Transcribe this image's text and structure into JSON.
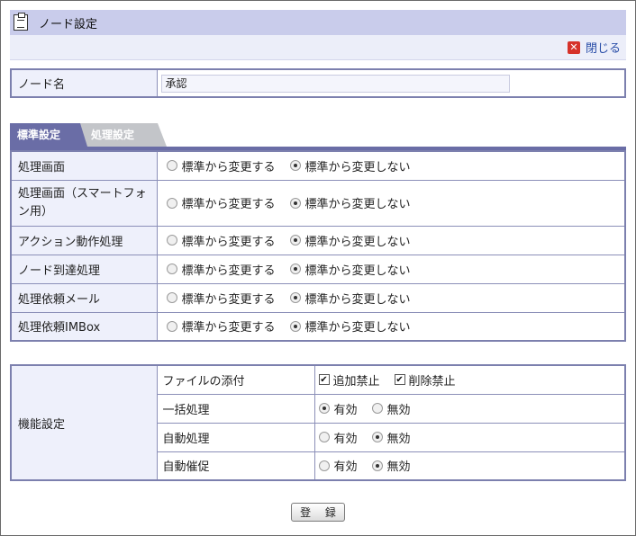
{
  "header": {
    "title": "ノード設定",
    "close_label": "閉じる"
  },
  "node_name": {
    "label": "ノード名",
    "value": "承認"
  },
  "tabs": [
    {
      "label": "標準設定",
      "active": true
    },
    {
      "label": "処理設定",
      "active": false
    }
  ],
  "radio_options": {
    "change": "標準から変更する",
    "no_change": "標準から変更しない"
  },
  "standard_settings": [
    {
      "label": "処理画面",
      "selected": "no_change"
    },
    {
      "label": "処理画面（スマートフォン用）",
      "selected": "no_change"
    },
    {
      "label": "アクション動作処理",
      "selected": "no_change"
    },
    {
      "label": "ノード到達処理",
      "selected": "no_change"
    },
    {
      "label": "処理依頼メール",
      "selected": "no_change"
    },
    {
      "label": "処理依頼IMBox",
      "selected": "no_change"
    }
  ],
  "function_settings": {
    "label": "機能設定",
    "attachment": {
      "label": "ファイルの添付",
      "add_forbid": {
        "label": "追加禁止",
        "checked": true
      },
      "delete_forbid": {
        "label": "削除禁止",
        "checked": true
      }
    },
    "rows": [
      {
        "label": "一括処理",
        "enabled_label": "有効",
        "disabled_label": "無効",
        "selected": "enabled"
      },
      {
        "label": "自動処理",
        "enabled_label": "有効",
        "disabled_label": "無効",
        "selected": "disabled"
      },
      {
        "label": "自動催促",
        "enabled_label": "有効",
        "disabled_label": "無効",
        "selected": "disabled"
      }
    ]
  },
  "submit_label": "登 録"
}
